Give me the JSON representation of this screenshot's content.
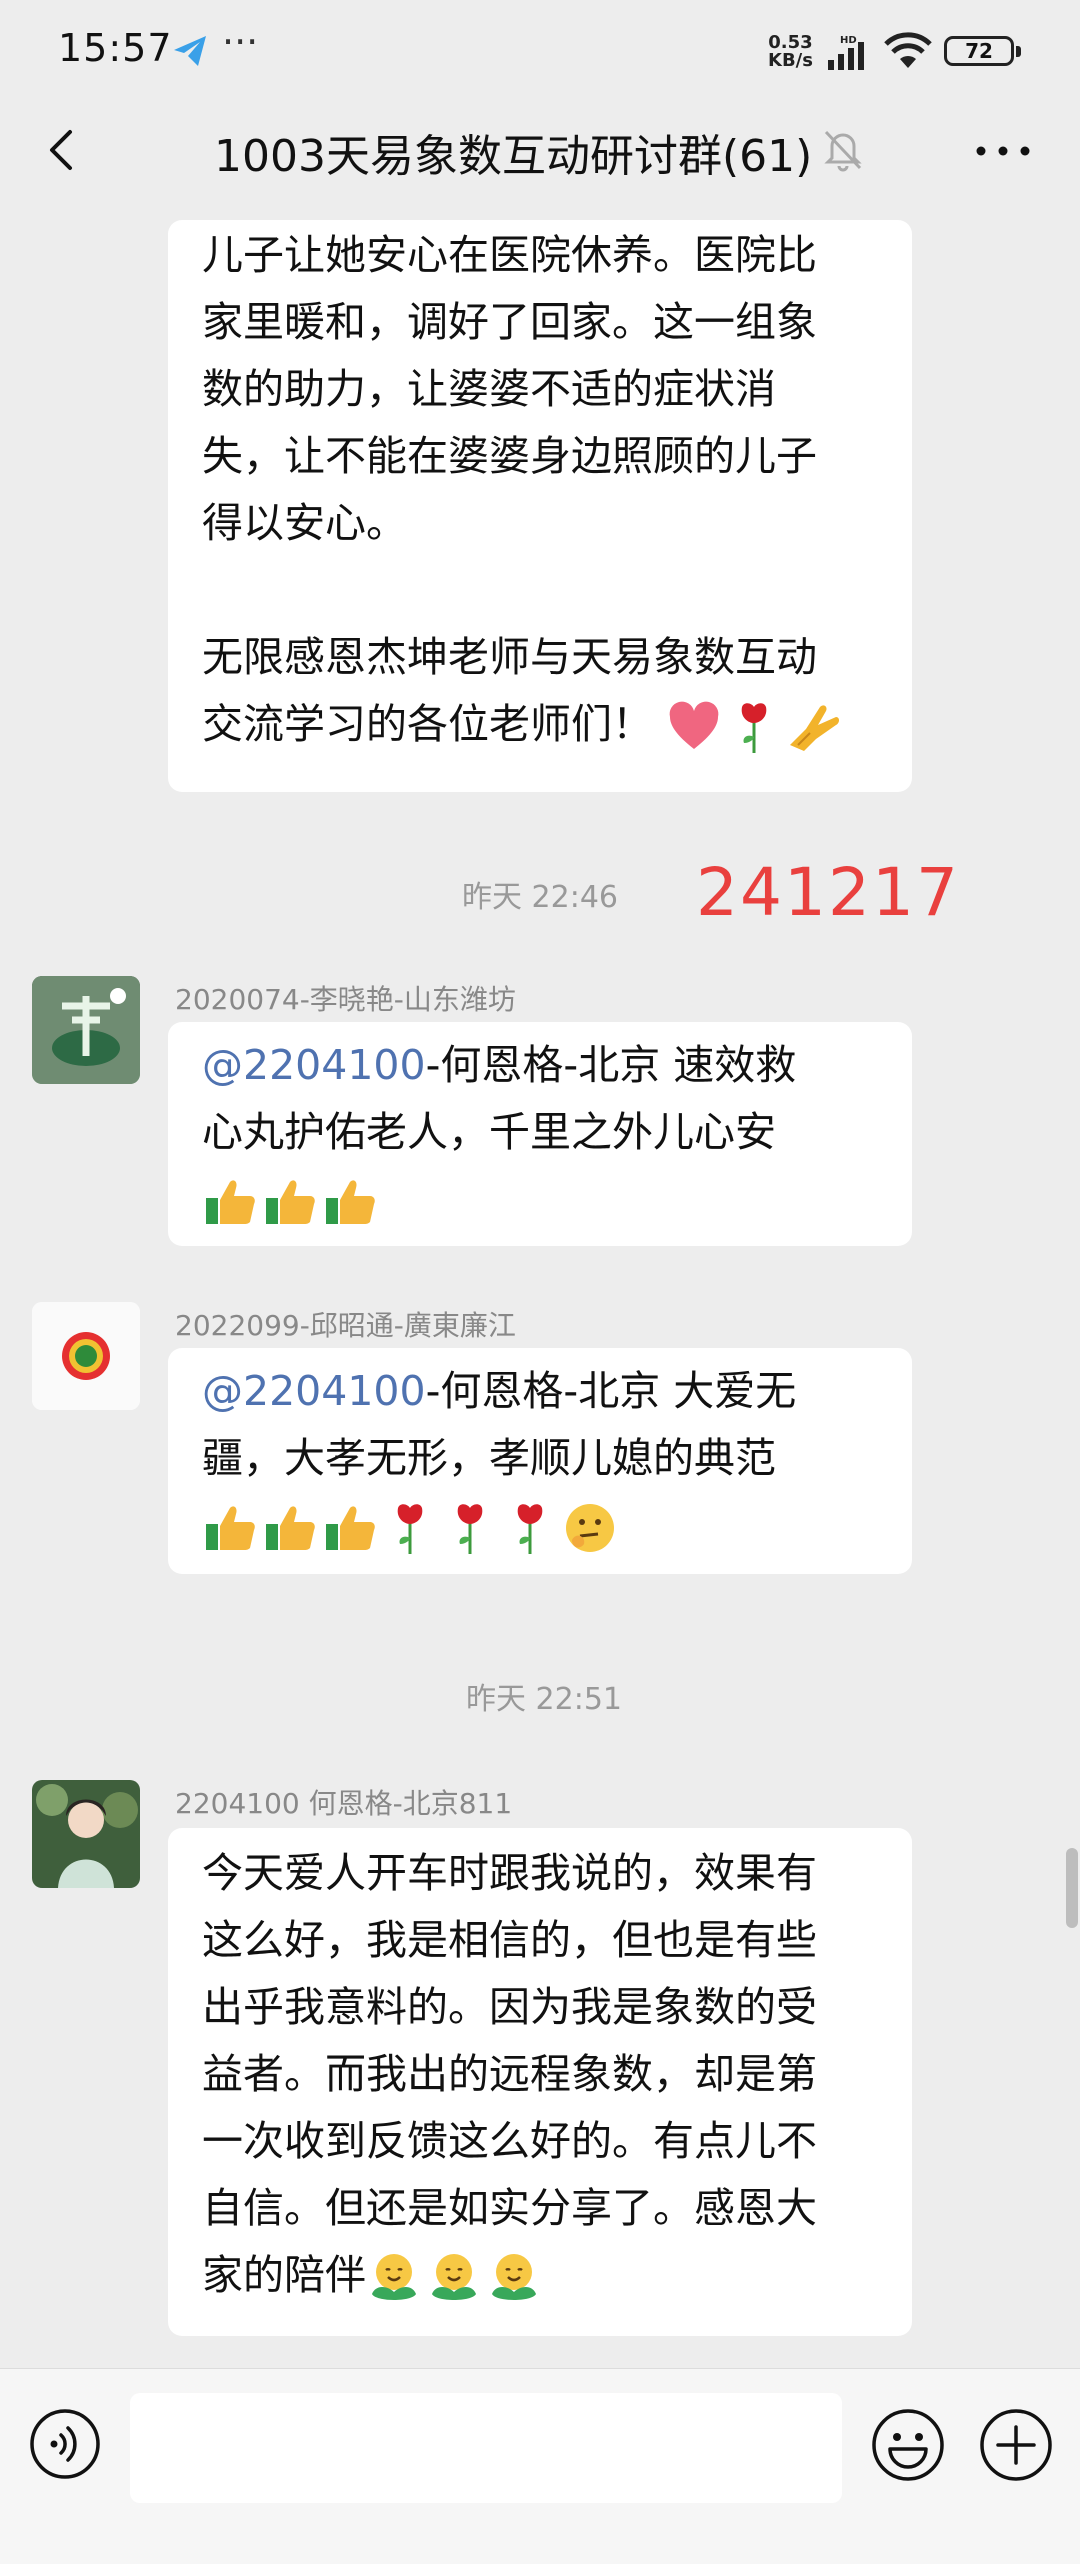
{
  "status_bar": {
    "time": "15:57",
    "more": "···",
    "speed_value": "0.53",
    "speed_unit": "KB/s",
    "network": "HD",
    "battery": "72"
  },
  "header": {
    "title": "1003天易象数互动研讨群(61)"
  },
  "messages": [
    {
      "lines": [
        "儿子让她安心在医院休养。医院比",
        "家里暖和，调好了回家。这一组象",
        "数的助力，让婆婆不适的症状消",
        "失，让不能在婆婆身边照顾的儿子",
        "得以安心。",
        "",
        "无限感恩杰坤老师与天易象数互动",
        "交流学习的各位老师们！"
      ]
    },
    {
      "sender": "2020074-李晓艳-山东潍坊",
      "mention": "@2204100",
      "line1_rest": "-何恩格-北京  速效救",
      "line2": "心丸护佑老人，千里之外儿心安"
    },
    {
      "sender": "2022099-邱昭通-廣東廉江",
      "mention": "@2204100",
      "line1_rest": "-何恩格-北京  大爱无",
      "line2": "疆，大孝无形，孝顺儿媳的典范"
    },
    {
      "sender": "2204100 何恩格-北京811",
      "lines": [
        "今天爱人开车时跟我说的，效果有",
        "这么好，我是相信的，但也是有些",
        "出乎我意料的。因为我是象数的受",
        "益者。而我出的远程象数，却是第",
        "一次收到反馈这么好的。有点儿不",
        "自信。但还是如实分享了。感恩大",
        "家的陪伴"
      ]
    }
  ],
  "timestamps": [
    "昨天 22:46",
    "昨天 22:51"
  ],
  "annotation": "241217",
  "icons": {
    "back": "back-chevron-icon",
    "mute": "bell-off-icon",
    "more": "more-dots-icon",
    "voice": "voice-icon",
    "emoji": "emoji-icon",
    "plus": "plus-icon"
  },
  "colors": {
    "background": "#ededed",
    "bubble": "#ffffff",
    "mention": "#4f72b0",
    "annotation": "#e9403e"
  }
}
